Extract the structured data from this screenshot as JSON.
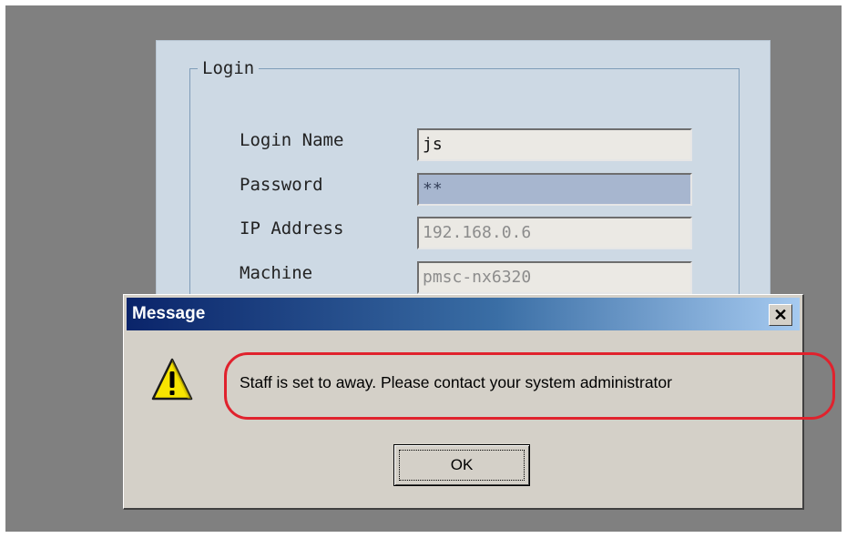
{
  "login": {
    "legend": "Login",
    "fields": [
      {
        "label": "Login Name",
        "value": "js"
      },
      {
        "label": "Password",
        "value": "**"
      },
      {
        "label": "IP Address",
        "value": "192.168.0.6"
      },
      {
        "label": "Machine",
        "value": "pmsc-nx6320"
      }
    ]
  },
  "message_dialog": {
    "title": "Message",
    "close_glyph": "✕",
    "icon": "warning-icon",
    "text": "Staff is set to away. Please contact your system administrator",
    "ok_label": "OK",
    "highlight_color": "#e0222d"
  },
  "colors": {
    "desktop": "#808080",
    "login_panel": "#cdd9e4",
    "title_bar_start": "#0a246a",
    "title_bar_end": "#a6caf0",
    "dialog_face": "#d4d0c8"
  }
}
